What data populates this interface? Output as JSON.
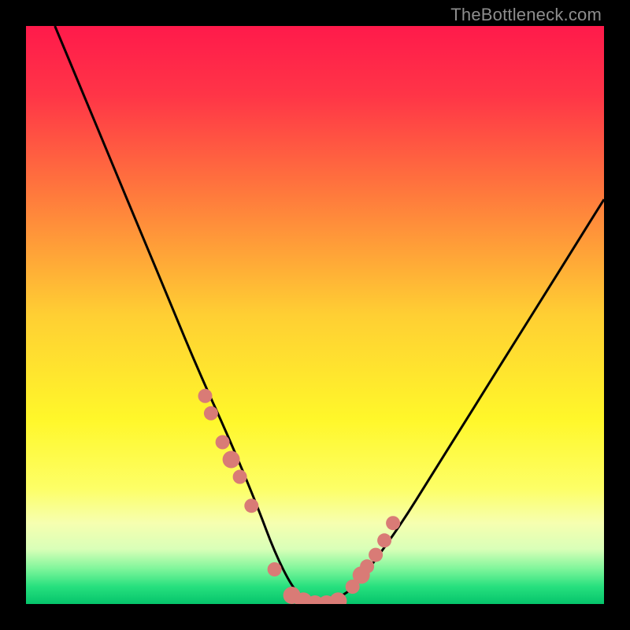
{
  "watermark": "TheBottleneck.com",
  "chart_data": {
    "type": "line",
    "title": "",
    "xlabel": "",
    "ylabel": "",
    "xlim": [
      0,
      100
    ],
    "ylim": [
      0,
      100
    ],
    "series": [
      {
        "name": "bottleneck-curve",
        "x": [
          5,
          10,
          15,
          20,
          25,
          30,
          35,
          40,
          43,
          46,
          48,
          50,
          52,
          54,
          57,
          60,
          65,
          70,
          75,
          80,
          85,
          90,
          95,
          100
        ],
        "y": [
          100,
          88,
          76,
          64,
          52,
          40,
          29,
          17,
          9,
          3,
          1,
          0,
          0,
          1,
          3,
          7,
          14,
          22,
          30,
          38,
          46,
          54,
          62,
          70
        ]
      }
    ],
    "markers": {
      "name": "highlight-dots",
      "x": [
        31,
        32,
        34,
        35.5,
        37,
        39,
        43,
        46,
        48,
        50,
        52,
        54,
        56.5,
        58,
        59,
        60.5,
        62,
        63.5
      ],
      "y": [
        36,
        33,
        28,
        25,
        22,
        17,
        6,
        1.5,
        0.5,
        0,
        0,
        0.5,
        3,
        5,
        6.5,
        8.5,
        11,
        14
      ],
      "color": "#d97b76",
      "size": [
        9,
        9,
        9,
        11,
        9,
        9,
        9,
        11,
        11,
        11,
        11,
        11,
        9,
        11,
        9,
        9,
        9,
        9
      ]
    },
    "gradient_stops": [
      {
        "offset": 0.0,
        "color": "#ff1a4b"
      },
      {
        "offset": 0.12,
        "color": "#ff3547"
      },
      {
        "offset": 0.3,
        "color": "#ff7d3c"
      },
      {
        "offset": 0.5,
        "color": "#ffcf33"
      },
      {
        "offset": 0.68,
        "color": "#fff72a"
      },
      {
        "offset": 0.8,
        "color": "#fdff66"
      },
      {
        "offset": 0.86,
        "color": "#f6ffb0"
      },
      {
        "offset": 0.905,
        "color": "#d9ffb8"
      },
      {
        "offset": 0.94,
        "color": "#7cf59a"
      },
      {
        "offset": 0.97,
        "color": "#27e07e"
      },
      {
        "offset": 1.0,
        "color": "#05c46b"
      }
    ]
  }
}
